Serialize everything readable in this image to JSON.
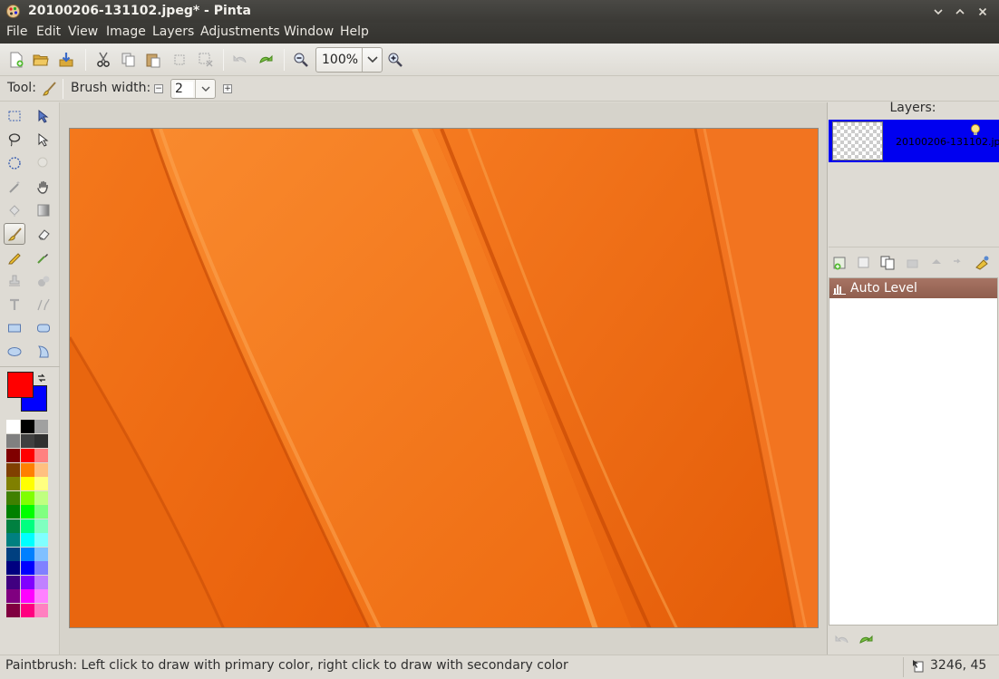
{
  "window": {
    "title": "20100206-131102.jpeg* - Pinta",
    "controls": [
      "minimize",
      "maximize",
      "close"
    ]
  },
  "menu": [
    "File",
    "Edit",
    "View",
    "Image",
    "Layers",
    "Adjustments",
    "Window",
    "Help"
  ],
  "toolbar": {
    "zoom_value": "100%"
  },
  "tool_options": {
    "tool_label": "Tool:",
    "brush_width_label": "Brush width:",
    "brush_width_value": "2"
  },
  "colors": {
    "primary": "#ff0000",
    "secondary": "#0000ff",
    "accent_selection": "#0000f0",
    "history_highlight": "#9b6a5a"
  },
  "palette": [
    [
      "#ffffff",
      "#000000",
      "#a0a0a0"
    ],
    [
      "#808080",
      "#404040",
      "#303030"
    ],
    [
      "#800000",
      "#ff0000",
      "#ff8080"
    ],
    [
      "#804000",
      "#ff8000",
      "#ffc080"
    ],
    [
      "#808000",
      "#ffff00",
      "#ffff80"
    ],
    [
      "#408000",
      "#80ff00",
      "#c0ff80"
    ],
    [
      "#008000",
      "#00ff00",
      "#80ff80"
    ],
    [
      "#008040",
      "#00ff80",
      "#80ffc0"
    ],
    [
      "#008080",
      "#00ffff",
      "#80ffff"
    ],
    [
      "#004080",
      "#0080ff",
      "#80c0ff"
    ],
    [
      "#000080",
      "#0000ff",
      "#8080ff"
    ],
    [
      "#400080",
      "#8000ff",
      "#c080ff"
    ],
    [
      "#800080",
      "#ff00ff",
      "#ff80ff"
    ],
    [
      "#800040",
      "#ff0080",
      "#ff80c0"
    ]
  ],
  "layers": {
    "header": "Layers:",
    "items": [
      {
        "name": "20100206-131102.jpeg",
        "visible": true
      }
    ]
  },
  "history": {
    "items": [
      "Auto Level"
    ]
  },
  "status": {
    "message": "Paintbrush: Left click to draw with primary color, right click to draw with secondary color",
    "coords": "3246, 45"
  }
}
